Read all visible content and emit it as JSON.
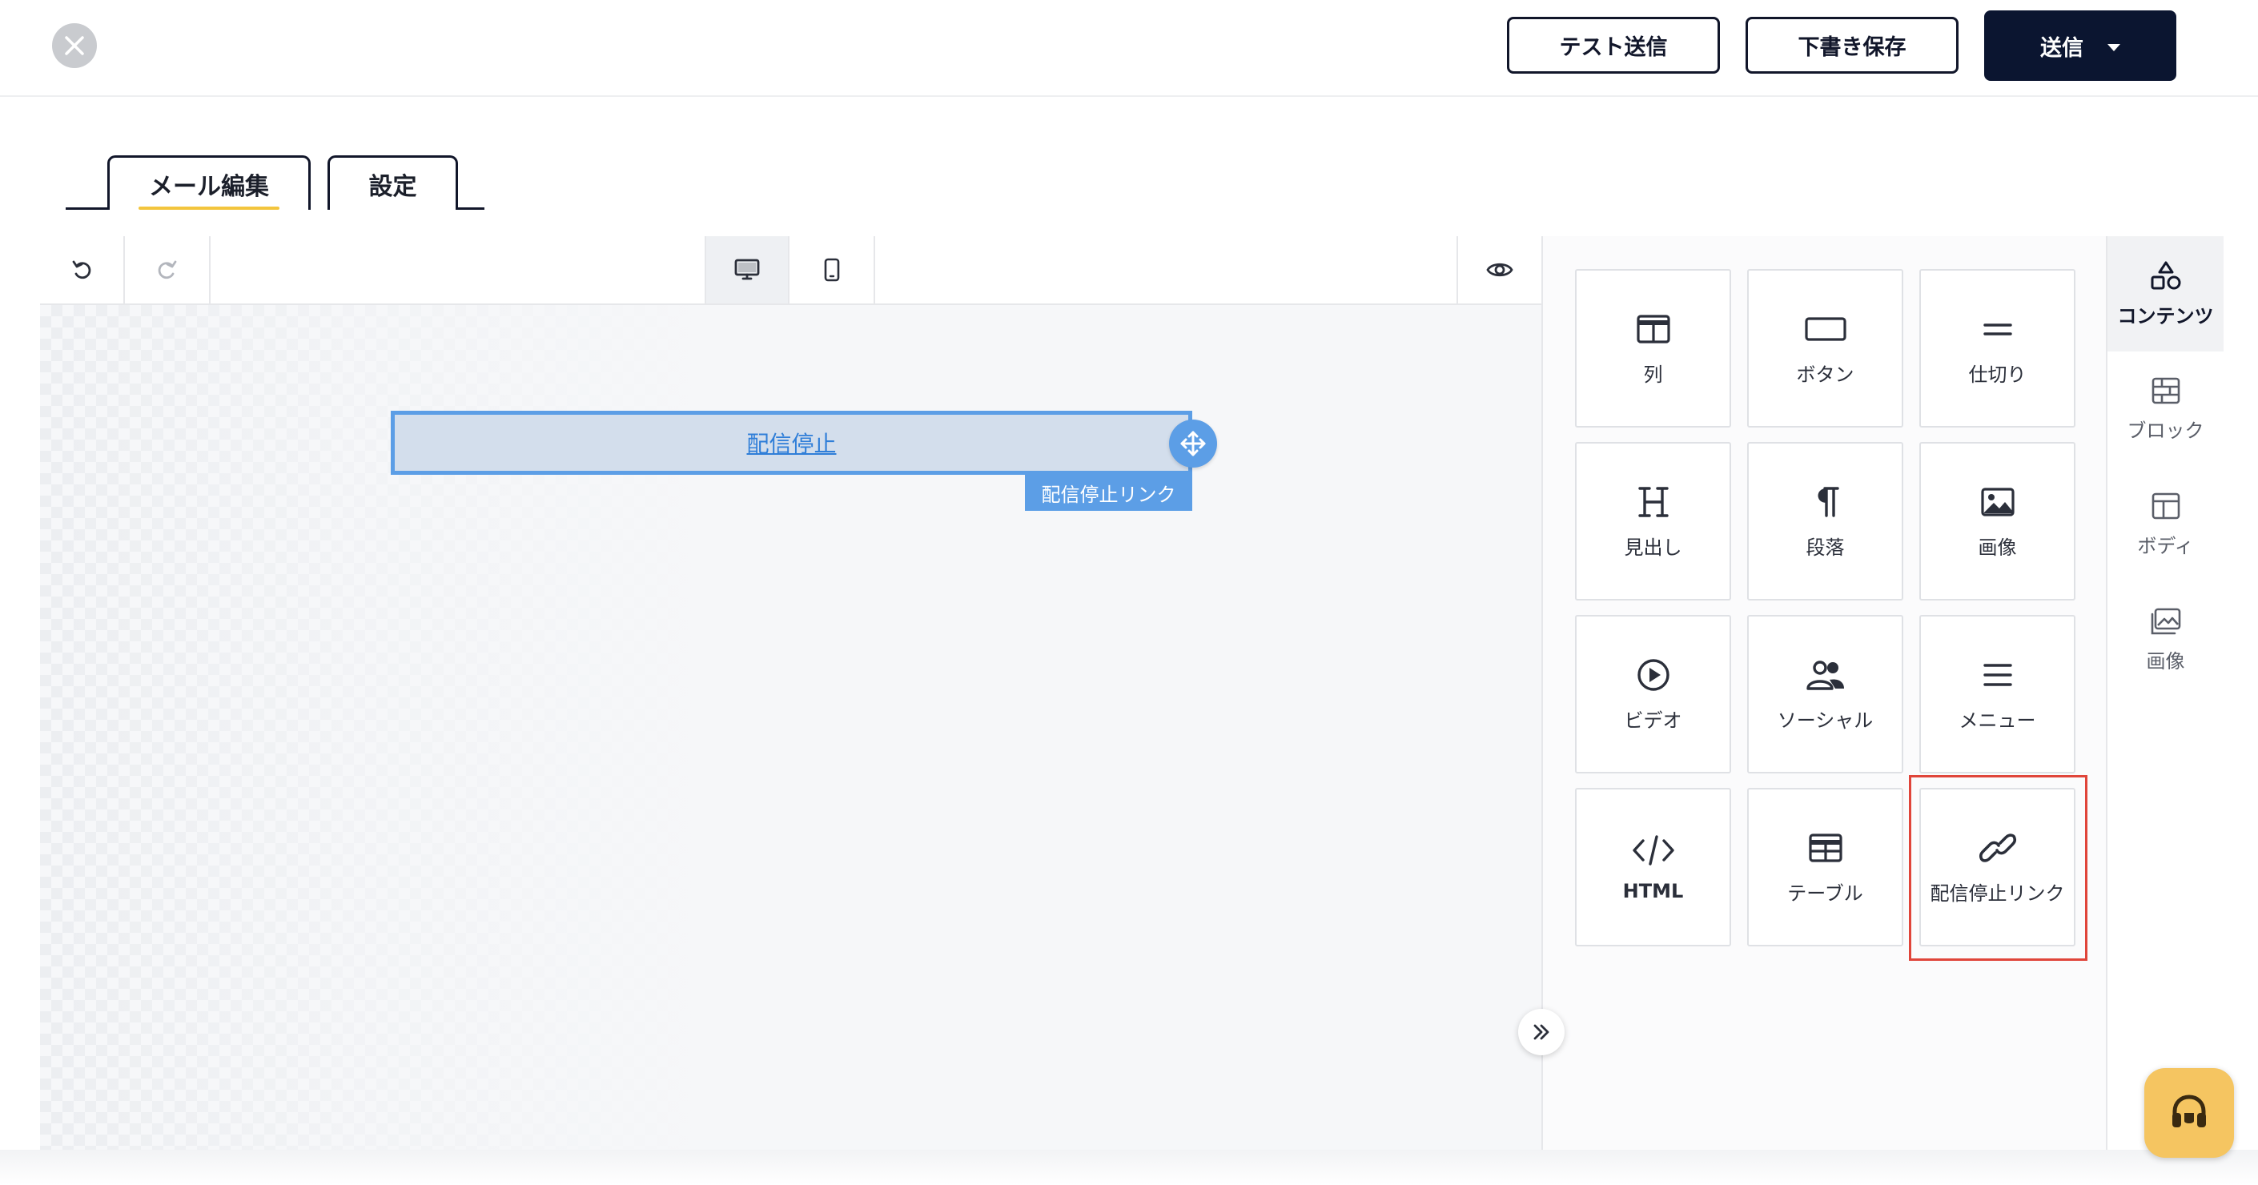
{
  "header": {
    "close_icon": "close-icon",
    "test_send_label": "テスト送信",
    "save_draft_label": "下書き保存",
    "send_label": "送信"
  },
  "tabs": [
    {
      "label": "メール編集",
      "active": true
    },
    {
      "label": "設定",
      "active": false
    }
  ],
  "toolbar": {
    "undo_icon": "undo-icon",
    "redo_icon": "redo-icon",
    "desktop_icon": "desktop-icon",
    "mobile_icon": "mobile-icon",
    "preview_icon": "eye-icon"
  },
  "canvas": {
    "block_link_text": "配信停止",
    "block_tag": "配信停止リンク"
  },
  "content_tiles": [
    {
      "label": "列",
      "icon": "columns-icon"
    },
    {
      "label": "ボタン",
      "icon": "button-icon"
    },
    {
      "label": "仕切り",
      "icon": "divider-icon"
    },
    {
      "label": "見出し",
      "icon": "heading-icon"
    },
    {
      "label": "段落",
      "icon": "paragraph-icon"
    },
    {
      "label": "画像",
      "icon": "image-icon"
    },
    {
      "label": "ビデオ",
      "icon": "video-icon"
    },
    {
      "label": "ソーシャル",
      "icon": "social-icon"
    },
    {
      "label": "メニュー",
      "icon": "menu-icon"
    },
    {
      "label": "HTML",
      "icon": "code-icon"
    },
    {
      "label": "テーブル",
      "icon": "table-icon"
    },
    {
      "label": "配信停止リンク",
      "icon": "link-icon",
      "highlighted": true
    }
  ],
  "side_tabs": [
    {
      "label": "コンテンツ",
      "icon": "shapes-icon",
      "active": true
    },
    {
      "label": "ブロック",
      "icon": "blocks-icon"
    },
    {
      "label": "ボディ",
      "icon": "layout-icon"
    },
    {
      "label": "画像",
      "icon": "images-icon"
    }
  ],
  "colors": {
    "primary_dark": "#0b1530",
    "accent_yellow": "#f3c53d",
    "selection_blue": "#5c9ee6",
    "highlight_red": "#e0453a",
    "support_button": "#f5c561"
  }
}
